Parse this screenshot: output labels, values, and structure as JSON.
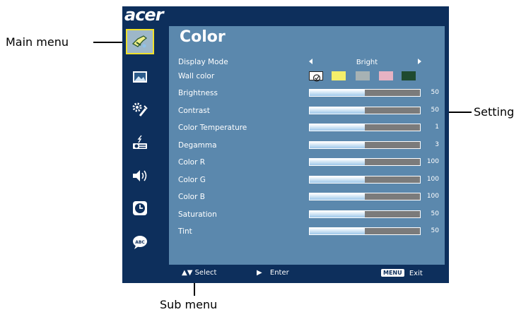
{
  "callouts": {
    "main_menu": "Main menu",
    "setting": "Setting",
    "sub_menu": "Sub menu"
  },
  "osd": {
    "logo": "acer",
    "title": "Color",
    "display_mode": {
      "label": "Display Mode",
      "value": "Bright"
    },
    "wall_color": {
      "label": "Wall color",
      "swatches": [
        "#ffffff",
        "#f4ee6a",
        "#a7b2b4",
        "#e6b2c3",
        "#1f4a30"
      ]
    },
    "sliders": [
      {
        "label": "Brightness",
        "value": "50",
        "level": 0.5
      },
      {
        "label": "Contrast",
        "value": "50",
        "level": 0.5
      },
      {
        "label": "Color Temperature",
        "value": "1",
        "level": 0.5
      },
      {
        "label": "Degamma",
        "value": "3",
        "level": 0.5
      },
      {
        "label": "Color R",
        "value": "100",
        "level": 0.5
      },
      {
        "label": "Color G",
        "value": "100",
        "level": 0.5
      },
      {
        "label": "Color B",
        "value": "100",
        "level": 0.5
      },
      {
        "label": "Saturation",
        "value": "50",
        "level": 0.5
      },
      {
        "label": "Tint",
        "value": "50",
        "level": 0.5
      }
    ],
    "footer": {
      "select": "Select",
      "enter": "Enter",
      "menu_key": "MENU",
      "exit": "Exit"
    },
    "menu_icons": [
      "color-palette-icon",
      "image-icon",
      "settings-tools-icon",
      "projector-icon",
      "speaker-icon",
      "clock-icon",
      "language-bubble-icon"
    ]
  }
}
